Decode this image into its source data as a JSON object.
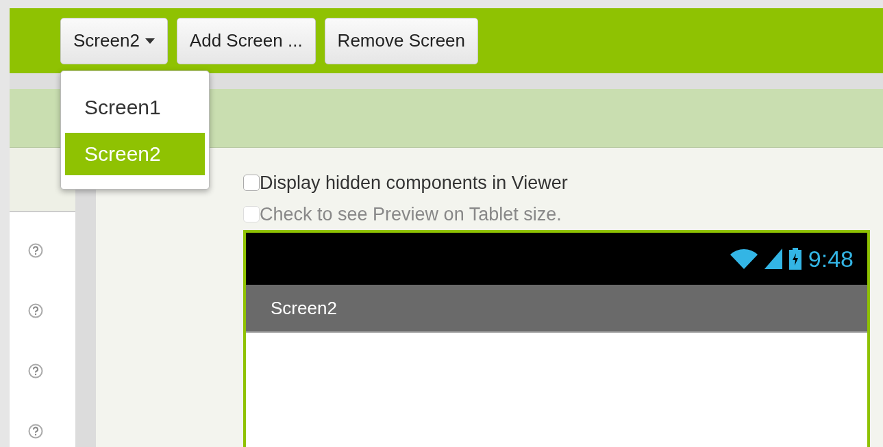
{
  "toolbar": {
    "buttons": [
      {
        "label": "Screen2",
        "kind": "dropdown"
      },
      {
        "label": "Add Screen ...",
        "kind": "plain"
      },
      {
        "label": "Remove Screen",
        "kind": "plain"
      }
    ]
  },
  "screen_menu": {
    "open": true,
    "items": [
      {
        "label": "Screen1",
        "selected": false
      },
      {
        "label": "Screen2",
        "selected": true
      }
    ]
  },
  "viewer_options": [
    {
      "label": "Display hidden components in Viewer",
      "checked": false,
      "disabled": false
    },
    {
      "label": "Check to see Preview on Tablet size.",
      "checked": false,
      "disabled": true
    }
  ],
  "phone": {
    "time": "9:48",
    "title": "Screen2"
  }
}
